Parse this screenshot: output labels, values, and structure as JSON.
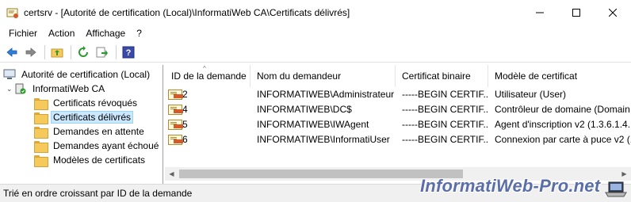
{
  "window": {
    "title": "certsrv - [Autorité de certification (Local)\\InformatiWeb CA\\Certificats délivrés]",
    "minimize": "—",
    "maximize": "☐",
    "close": "✕"
  },
  "menu": [
    "Fichier",
    "Action",
    "Affichage",
    "?"
  ],
  "toolbar": {
    "icons": [
      "back-icon",
      "forward-icon",
      "up-folder-icon",
      "refresh-icon",
      "export-icon",
      "help-icon"
    ]
  },
  "tree": {
    "root": "Autorité de certification (Local)",
    "ca": "InformatiWeb CA",
    "items": [
      {
        "label": "Certificats révoqués"
      },
      {
        "label": "Certificats délivrés",
        "selected": true
      },
      {
        "label": "Demandes en attente"
      },
      {
        "label": "Demandes ayant échoué"
      },
      {
        "label": "Modèles de certificats"
      }
    ]
  },
  "list": {
    "columns": [
      "ID de la demande",
      "Nom du demandeur",
      "Certificat binaire",
      "Modèle de certificat"
    ],
    "rows": [
      {
        "id": "2",
        "requester": "INFORMATIWEB\\Administrateur",
        "binary": "-----BEGIN CERTIF...",
        "template": "Utilisateur (User)"
      },
      {
        "id": "4",
        "requester": "INFORMATIWEB\\DC$",
        "binary": "-----BEGIN CERTIF...",
        "template": "Contrôleur de domaine (Domain"
      },
      {
        "id": "5",
        "requester": "INFORMATIWEB\\IWAgent",
        "binary": "-----BEGIN CERTIF...",
        "template": "Agent d'inscription v2 (1.3.6.1.4."
      },
      {
        "id": "6",
        "requester": "INFORMATIWEB\\InformatiUser",
        "binary": "-----BEGIN CERTIF...",
        "template": "Connexion par carte à puce v2 (1"
      }
    ]
  },
  "status": "Trié en ordre croissant par ID de la demande",
  "watermark": "InformatiWeb-Pro.net"
}
